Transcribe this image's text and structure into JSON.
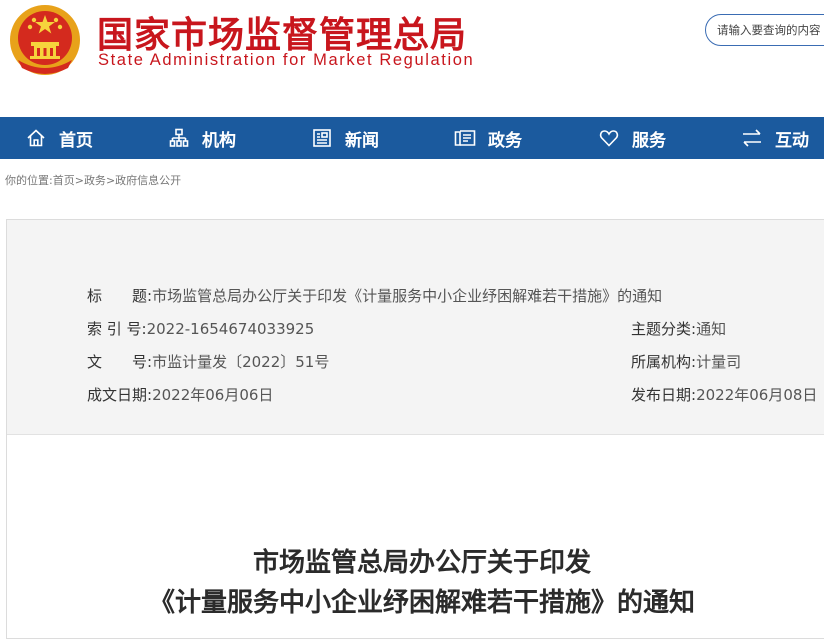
{
  "header": {
    "title_cn": "国家市场监督管理总局",
    "title_en": "State Administration for Market Regulation",
    "search_placeholder": "请输入要查询的内容",
    "accent_color": "#c8161d"
  },
  "nav": {
    "background": "#1b5a9e",
    "items": [
      {
        "label": "首页",
        "icon": "home-icon"
      },
      {
        "label": "机构",
        "icon": "org-chart-icon"
      },
      {
        "label": "新闻",
        "icon": "newspaper-icon"
      },
      {
        "label": "政务",
        "icon": "document-icon"
      },
      {
        "label": "服务",
        "icon": "heart-icon"
      },
      {
        "label": "互动",
        "icon": "swap-arrows-icon"
      }
    ]
  },
  "breadcrumb": {
    "prefix": "你的位置:",
    "items": [
      "首页",
      "政务",
      "政府信息公开"
    ],
    "separator": ">"
  },
  "meta": {
    "title_label": "标　　题:",
    "title_value": "市场监管总局办公厅关于印发《计量服务中小企业纾困解难若干措施》的通知",
    "index_label": "索 引 号:",
    "index_value": "2022-1654674033925",
    "topic_label": "主题分类:",
    "topic_value": "通知",
    "docno_label": "文　　号:",
    "docno_value": "市监计量发〔2022〕51号",
    "org_label": "所属机构:",
    "org_value": "计量司",
    "created_label": "成文日期:",
    "created_value": "2022年06月06日",
    "published_label": "发布日期:",
    "published_value": "2022年06月08日"
  },
  "document": {
    "title_line1": "市场监管总局办公厅关于印发",
    "title_line2": "《计量服务中小企业纾困解难若干措施》的通知"
  }
}
